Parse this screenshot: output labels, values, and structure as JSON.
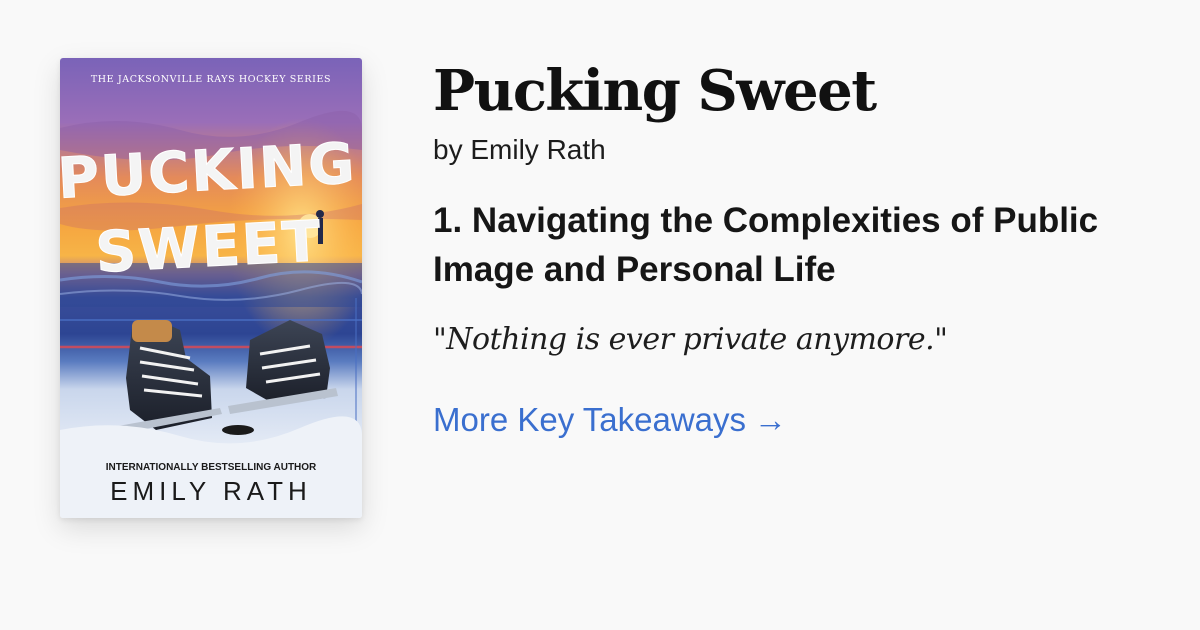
{
  "book": {
    "title": "Pucking Sweet",
    "author_line": "by Emily Rath",
    "cover": {
      "series_line": "THE JACKSONVILLE RAYS HOCKEY SERIES",
      "title_line_1": "PUCKING",
      "title_line_2": "SWEET",
      "tagline": "INTERNATIONALLY BESTSELLING AUTHOR",
      "author": "EMILY RATH"
    }
  },
  "takeaway": {
    "heading": "1. Navigating the Complexities of Public Image and Personal Life",
    "quote": "\"Nothing is ever private anymore.\""
  },
  "link": {
    "label": "More Key Takeaways",
    "arrow": "→"
  },
  "colors": {
    "background": "#f9f9f9",
    "link": "#3a6fcf",
    "title_text": "#111111"
  }
}
